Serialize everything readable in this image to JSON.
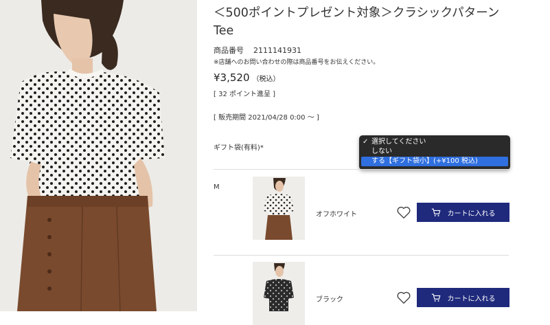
{
  "product": {
    "title_line1": "＜500ポイントプレゼント対象＞クラシックパターン",
    "title_line2": "Tee",
    "sku_label": "商品番号",
    "sku_value": "2111141931",
    "note": "※店舗へのお問い合わせの際は商品番号をお伝えください。",
    "price": "¥3,520",
    "price_tax": "（税込）",
    "points": "[ 32 ポイント進呈 ]",
    "period": "[ 販売期間 2021/04/28 0:00 〜 ]"
  },
  "gift": {
    "label": "ギフト袋(有料)",
    "required_mark": "*",
    "options": [
      {
        "label": "選択してください",
        "checked": true
      },
      {
        "label": "しない",
        "checked": false
      },
      {
        "label": "する【ギフト袋小】(+¥100 税込)",
        "checked": false,
        "highlighted": true
      }
    ]
  },
  "variants": {
    "size": "M",
    "items": [
      {
        "color": "オフホワイト",
        "button": "カートに入れる"
      },
      {
        "color": "ブラック",
        "button": "カートに入れる"
      }
    ]
  },
  "colors": {
    "button_bg": "#1f2a7c",
    "dropdown_bg": "#2a2a2a",
    "dropdown_highlight": "#2f6fdf",
    "pants_brown": "#7a4a2e"
  },
  "icons": [
    "heart-icon",
    "cart-icon",
    "check-icon"
  ]
}
